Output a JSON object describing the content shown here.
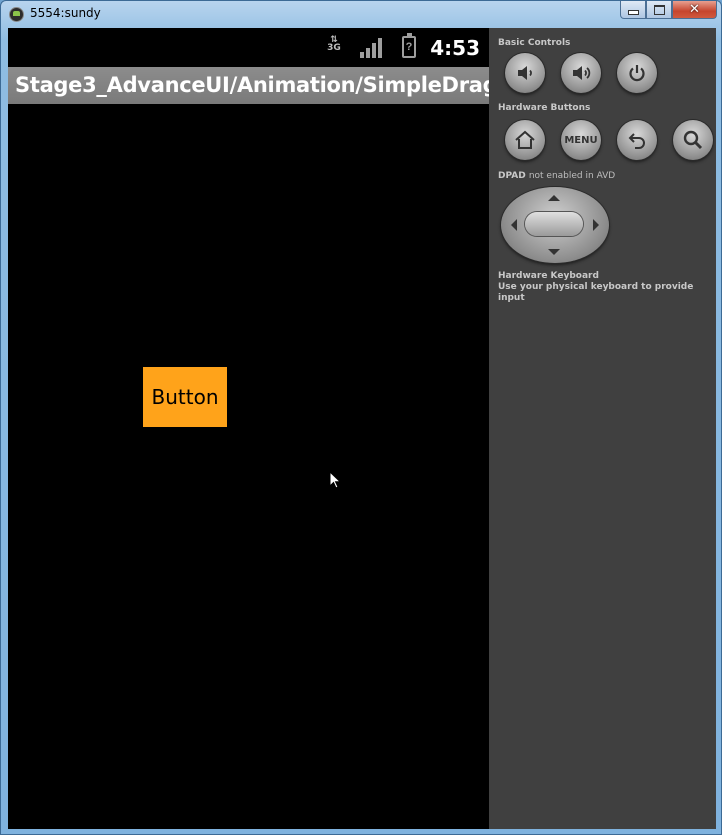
{
  "window": {
    "title": "5554:sundy",
    "controls": {
      "minimize": "minimize",
      "maximize": "maximize",
      "close": "✕"
    }
  },
  "statusbar": {
    "network": "3G",
    "battery_glyph": "?",
    "time": "4:53"
  },
  "actionbar": {
    "title": "Stage3_AdvanceUI/Animation/SimpleDrag"
  },
  "content": {
    "button_label": "Button"
  },
  "controls_panel": {
    "basic_controls_label": "Basic Controls",
    "basic_controls": [
      "volume-down-icon",
      "volume-up-icon",
      "power-icon"
    ],
    "hardware_buttons_label": "Hardware Buttons",
    "hardware_buttons": [
      "home-icon",
      "MENU",
      "back-icon",
      "search-icon"
    ],
    "menu_label": "MENU",
    "dpad_label": "DPAD",
    "dpad_note": "not enabled in AVD",
    "keyboard_title": "Hardware Keyboard",
    "keyboard_note": "Use your physical keyboard to provide input"
  },
  "colors": {
    "button_bg": "#ffa31a",
    "actionbar_bg": "#7a7a7a",
    "panel_bg": "#404040"
  }
}
